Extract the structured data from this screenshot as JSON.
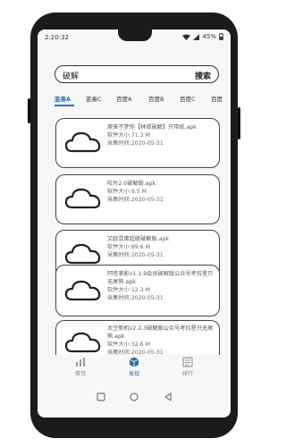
{
  "status": {
    "time": "2:20:32",
    "battery": "45%"
  },
  "search": {
    "query": "破解",
    "button": "搜索"
  },
  "tabs": [
    {
      "label": "蓝奏A"
    },
    {
      "label": "蓝奏C"
    },
    {
      "label": "百度A"
    },
    {
      "label": "百度B"
    },
    {
      "label": "百度C"
    },
    {
      "label": "百度"
    }
  ],
  "results": [
    {
      "title": "原来不梦你【林成破解】只带纸.apk",
      "size": "软件大小:71.3 M",
      "date": "采集时间:2020-05-31"
    },
    {
      "title": "咬片2.0破解版.apk",
      "size": "软件大小:9.5 M",
      "date": "采集时间:2020-05-31"
    },
    {
      "title": "又欧混蛋超级破解版.apk",
      "size": "软件大小:89.6 M",
      "date": "采集时间:2020-05-31"
    },
    {
      "title": "阿苍美影v1.1.9会员破解版公众号考拉星只无尾熊.apk",
      "size": "软件大小:12.3 M",
      "date": "采集时间:2020-05-31"
    },
    {
      "title": "太空新机v2.2.3破解版公众号考拉星只无尾熊.apk",
      "size": "软件大小:32.6 M",
      "date": "采集时间:2020-05-31"
    }
  ],
  "nav": {
    "home": "首页",
    "discover": "发现",
    "ranking": "排行"
  },
  "colors": {
    "accent": "#2a6ea8"
  }
}
